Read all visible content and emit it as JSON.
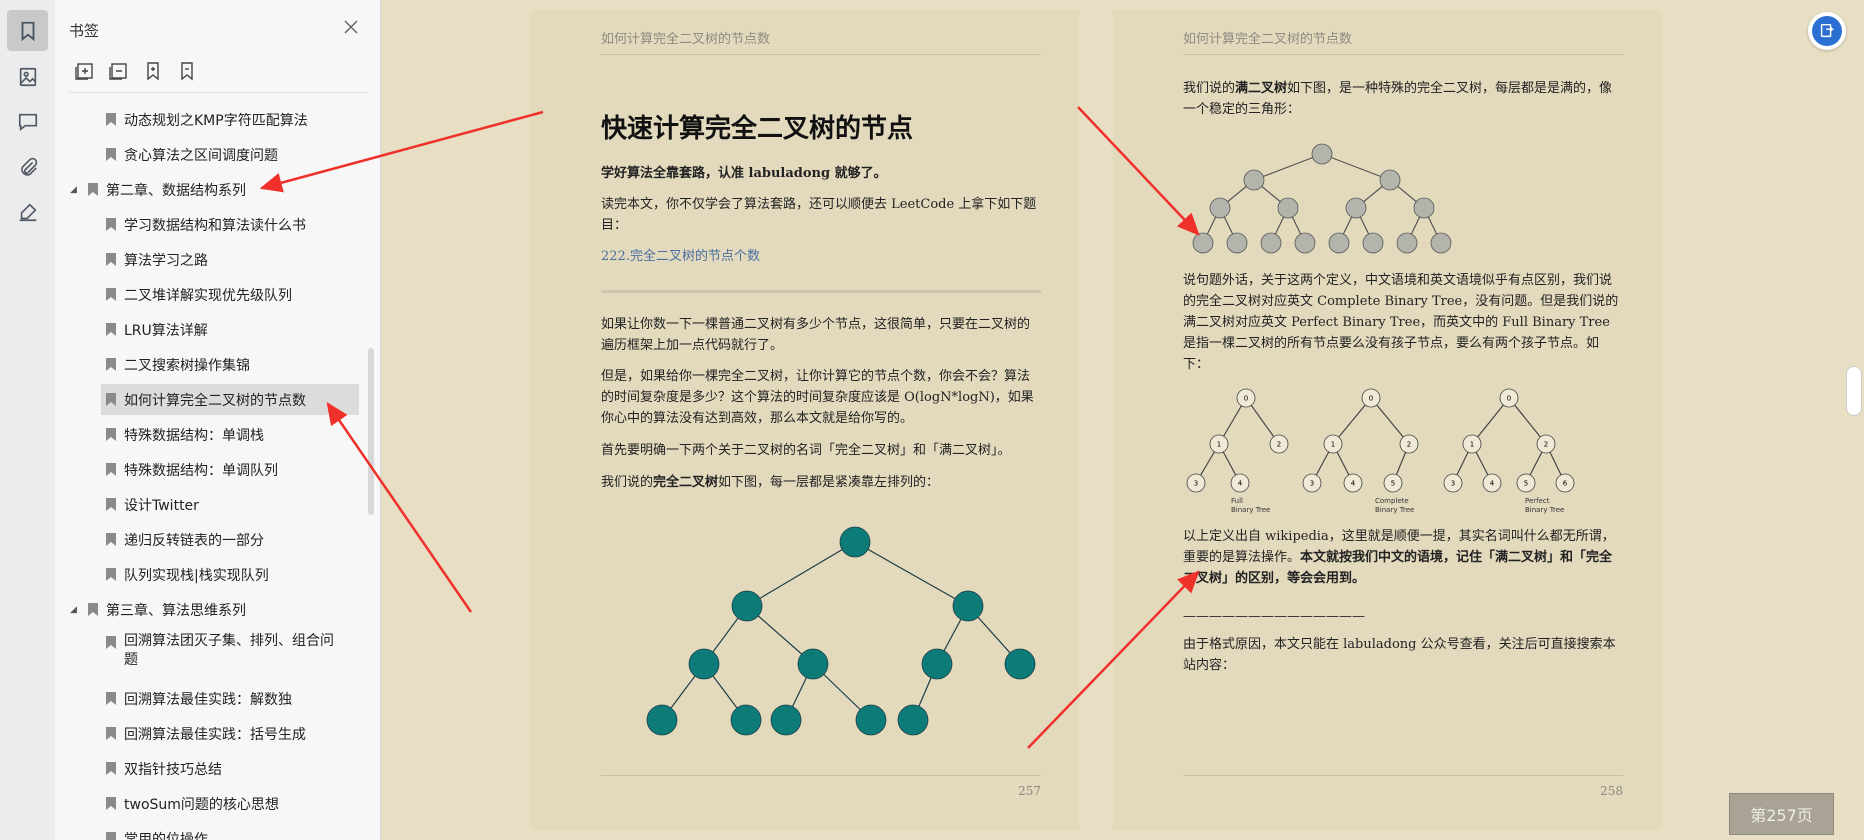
{
  "sidebar": {
    "title": "书签",
    "items": [
      {
        "label": "动态规划之KMP字符匹配算法",
        "level": 2
      },
      {
        "label": "贪心算法之区间调度问题",
        "level": 2
      },
      {
        "label": "第二章、数据结构系列",
        "level": 1
      },
      {
        "label": "学习数据结构和算法读什么书",
        "level": 2
      },
      {
        "label": "算法学习之路",
        "level": 2
      },
      {
        "label": "二叉堆详解实现优先级队列",
        "level": 2
      },
      {
        "label": "LRU算法详解",
        "level": 2
      },
      {
        "label": "二叉搜索树操作集锦",
        "level": 2
      },
      {
        "label": "如何计算完全二叉树的节点数",
        "level": 2,
        "selected": true
      },
      {
        "label": "特殊数据结构：单调栈",
        "level": 2
      },
      {
        "label": "特殊数据结构：单调队列",
        "level": 2
      },
      {
        "label": "设计Twitter",
        "level": 2
      },
      {
        "label": "递归反转链表的一部分",
        "level": 2
      },
      {
        "label": "队列实现栈|栈实现队列",
        "level": 2
      },
      {
        "label": "第三章、算法思维系列",
        "level": 1
      },
      {
        "label": "回溯算法团灭子集、排列、组合问题",
        "level": 2
      },
      {
        "label": "回溯算法最佳实践：解数独",
        "level": 2
      },
      {
        "label": "回溯算法最佳实践：括号生成",
        "level": 2
      },
      {
        "label": "双指针技巧总结",
        "level": 2
      },
      {
        "label": "twoSum问题的核心思想",
        "level": 2
      },
      {
        "label": "常用的位操作",
        "level": 2
      }
    ]
  },
  "page1": {
    "running_head": "如何计算完全二叉树的节点数",
    "title": "快速计算完全二叉树的节点",
    "p1": "学好算法全靠套路，认准 labuladong 就够了。",
    "p2": "读完本文，你不仅学会了算法套路，还可以顺便去 LeetCode 上拿下如下题目：",
    "link": "222.完全二叉树的节点个数",
    "p3": "如果让你数一下一棵普通二叉树有多少个节点，这很简单，只要在二叉树的遍历框架上加一点代码就行了。",
    "p4": "但是，如果给你一棵完全二叉树，让你计算它的节点个数，你会不会？算法的时间复杂度是多少？这个算法的时间复杂度应该是 O(logN*logN)，如果你心中的算法没有达到高效，那么本文就是给你写的。",
    "p5": "首先要明确一下两个关于二叉树的名词「完全二叉树」和「满二叉树」。",
    "p6_a": "我们说的",
    "p6_b": "完全二叉树",
    "p6_c": "如下图，每一层都是紧凑靠左排列的：",
    "page_number": "257"
  },
  "page2": {
    "running_head": "如何计算完全二叉树的节点数",
    "p1_a": "我们说的",
    "p1_b": "满二叉树",
    "p1_c": "如下图，是一种特殊的完全二叉树，每层都是是满的，像一个稳定的三角形：",
    "p2": "说句题外话，关于这两个定义，中文语境和英文语境似乎有点区别，我们说的完全二叉树对应英文 Complete Binary Tree，没有问题。但是我们说的满二叉树对应英文 Perfect Binary Tree，而英文中的 Full Binary Tree 是指一棵二叉树的所有节点要么没有孩子节点，要么有两个孩子节点。如下：",
    "fig_labels": {
      "full_1": "Full",
      "full_2": "Binary Tree",
      "complete_1": "Complete",
      "complete_2": "Binary Tree",
      "perfect_1": "Perfect",
      "perfect_2": "Binary Tree"
    },
    "p3_a": "以上定义出自 wikipedia，这里就是顺便一提，其实名词叫什么都无所谓，重要的是算法操作。",
    "p3_b": "本文就按我们中文的语境，记住「满二叉树」和「完全二叉树」的区别，等会会用到。",
    "divider": "——————————————",
    "p4": "由于格式原因，本文只能在 labuladong 公众号查看，关注后可直接搜索本站内容：",
    "page_number": "258"
  },
  "page_button": "第257页",
  "colors": {
    "tree_teal": "#0d7b78",
    "tree_gray": "#b3b5ad",
    "arrow_red": "#f0302a"
  }
}
